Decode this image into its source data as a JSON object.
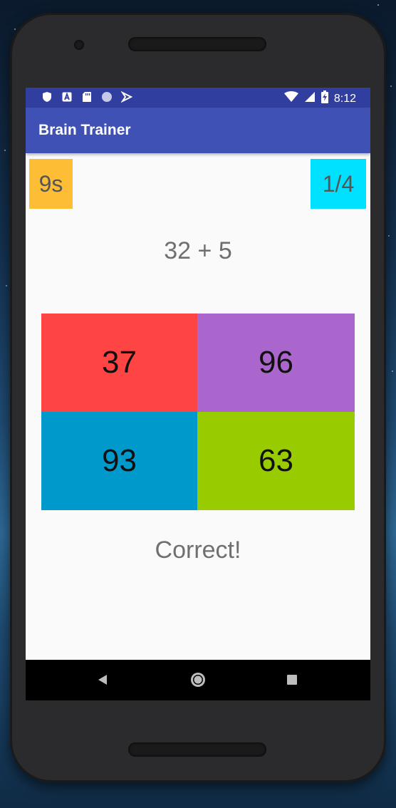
{
  "status_bar": {
    "time": "8:12",
    "left_icons": [
      "shield-icon",
      "a-notification-icon",
      "sd-card-icon",
      "circle-icon",
      "play-protect-icon"
    ],
    "right_icons": [
      "wifi-icon",
      "cell-signal-icon",
      "battery-charging-icon"
    ]
  },
  "toolbar": {
    "title": "Brain Trainer",
    "color": "#3f51b5",
    "status_color": "#303f9f"
  },
  "game": {
    "timer": "9s",
    "timer_color": "#fdbd34",
    "score": "1/4",
    "score_color": "#00e1ff",
    "question": "32 + 5",
    "answers": [
      {
        "label": "37",
        "color": "#ff4444"
      },
      {
        "label": "96",
        "color": "#aa66cc"
      },
      {
        "label": "93",
        "color": "#0099cc"
      },
      {
        "label": "63",
        "color": "#99cc00"
      }
    ],
    "result": "Correct!"
  },
  "nav_bar": {
    "buttons": [
      "back-icon",
      "home-icon",
      "recents-icon"
    ]
  }
}
